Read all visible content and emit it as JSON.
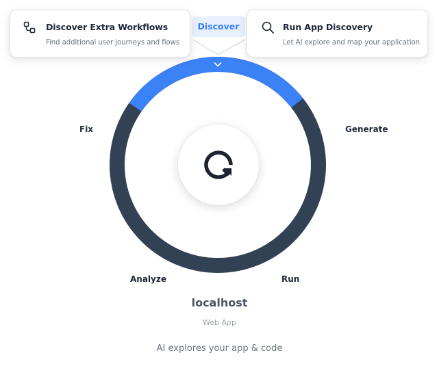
{
  "cards": {
    "left": {
      "title": "Discover Extra Workflows",
      "subtitle": "Find additional user journeys and flows",
      "icon": "workflow-icon"
    },
    "right": {
      "title": "Run App Discovery",
      "subtitle": "Let AI explore and map your application",
      "icon": "search-icon"
    }
  },
  "active_tab": "Discover",
  "steps": {
    "fix": "Fix",
    "generate": "Generate",
    "analyze": "Analyze",
    "run": "Run"
  },
  "center": {
    "logo": "q-logo-icon"
  },
  "app": {
    "name": "localhost",
    "type": "Web App"
  },
  "tagline": "AI explores your app & code",
  "colors": {
    "ring": "#334155",
    "active_segment": "#3b82f6",
    "active_tab_bg": "#e8f0fe",
    "logo": "#1f2230"
  }
}
